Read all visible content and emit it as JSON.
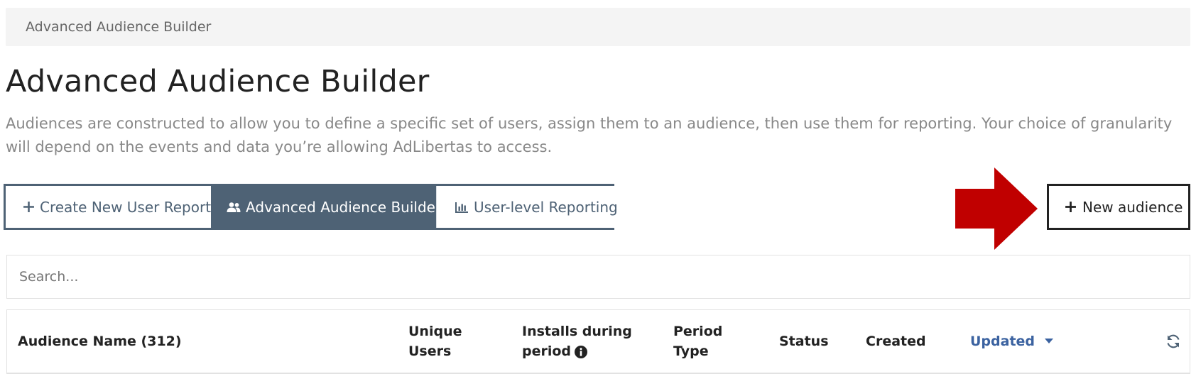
{
  "breadcrumb": {
    "current": "Advanced Audience Builder"
  },
  "page": {
    "title": "Advanced Audience Builder",
    "description": "Audiences are constructed to allow you to define a specific set of users, assign them to an audience, then use them for reporting. Your choice of granularity will depend on the events and data you’re allowing AdLibertas to access."
  },
  "tabs": [
    {
      "label": "Create New User Report",
      "icon": "plus-icon",
      "active": false
    },
    {
      "label": "Advanced Audience Builder",
      "icon": "users-icon",
      "active": true
    },
    {
      "label": "User-level Reporting",
      "icon": "bar-chart-icon",
      "active": false
    }
  ],
  "actions": {
    "new_audience_label": "New audience"
  },
  "search": {
    "placeholder": "Search..."
  },
  "table": {
    "columns": [
      {
        "line1": "Audience Name (312)",
        "line2": ""
      },
      {
        "line1": "Unique",
        "line2": "Users"
      },
      {
        "line1": "Installs during",
        "line2": "period"
      },
      {
        "line1": "Period",
        "line2": "Type"
      },
      {
        "line1": "Status",
        "line2": ""
      },
      {
        "line1": "Created",
        "line2": ""
      },
      {
        "line1": "Updated",
        "line2": "",
        "sorted": "desc"
      }
    ]
  },
  "colors": {
    "accent": "#4e6275",
    "sort_link": "#3b62a0",
    "annotation_arrow": "#c00000"
  }
}
